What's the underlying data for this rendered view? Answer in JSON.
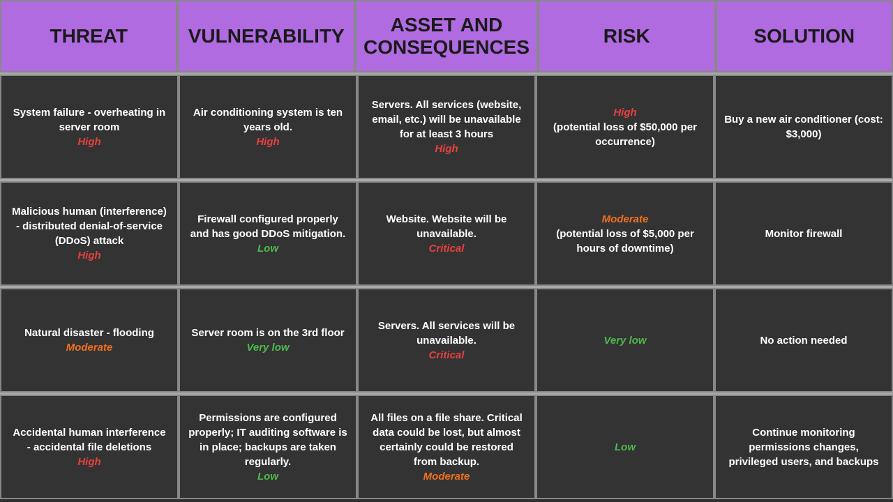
{
  "headers": [
    {
      "id": "threat",
      "label": "THREAT"
    },
    {
      "id": "vulnerability",
      "label": "VULNERABILITY"
    },
    {
      "id": "asset",
      "label": "ASSET AND\nCONSEQUENCES"
    },
    {
      "id": "risk",
      "label": "RISK"
    },
    {
      "id": "solution",
      "label": "SOLUTION"
    }
  ],
  "rows": [
    {
      "threat": {
        "text": "System failure - overheating in server room",
        "severity": "High",
        "severityClass": "high"
      },
      "vulnerability": {
        "text": "Air conditioning system is ten years old.",
        "severity": "High",
        "severityClass": "high"
      },
      "asset": {
        "text": "Servers. All services (website, email, etc.) will be unavailable for at least 3 hours",
        "severity": "High",
        "severityClass": "high"
      },
      "risk": {
        "severity": "High",
        "severityClass": "high",
        "extra": "(potential loss of $50,000 per occurrence)"
      },
      "solution": {
        "text": "Buy a new air conditioner (cost: $3,000)"
      }
    },
    {
      "threat": {
        "text": "Malicious human (interference) - distributed denial-of-service (DDoS) attack",
        "severity": "High",
        "severityClass": "high"
      },
      "vulnerability": {
        "text": "Firewall configured properly and has good DDoS mitigation.",
        "severity": "Low",
        "severityClass": "low"
      },
      "asset": {
        "text": "Website. Website will be unavailable.",
        "severity": "Critical",
        "severityClass": "critical"
      },
      "risk": {
        "severity": "Moderate",
        "severityClass": "moderate",
        "extra": "(potential loss of $5,000 per hours of downtime)"
      },
      "solution": {
        "text": "Monitor firewall"
      }
    },
    {
      "threat": {
        "text": "Natural disaster - flooding",
        "severity": "Moderate",
        "severityClass": "moderate"
      },
      "vulnerability": {
        "text": "Server room is on the 3rd floor",
        "severity": "Very low",
        "severityClass": "very-low"
      },
      "asset": {
        "text": "Servers. All services will be unavailable.",
        "severity": "Critical",
        "severityClass": "critical"
      },
      "risk": {
        "severity": "Very low",
        "severityClass": "very-low",
        "extra": ""
      },
      "solution": {
        "text": "No action needed"
      }
    },
    {
      "threat": {
        "text": "Accidental human interference - accidental file deletions",
        "severity": "High",
        "severityClass": "high"
      },
      "vulnerability": {
        "text": "Permissions are configured properly; IT auditing software is in place; backups are taken regularly.",
        "severity": "Low",
        "severityClass": "low"
      },
      "asset": {
        "text": "All files on a file share. Critical data could be lost, but almost certainly could be restored from backup.",
        "severity": "Moderate",
        "severityClass": "moderate"
      },
      "risk": {
        "severity": "Low",
        "severityClass": "low",
        "extra": ""
      },
      "solution": {
        "text": "Continue monitoring permissions changes, privileged users, and backups"
      }
    }
  ]
}
